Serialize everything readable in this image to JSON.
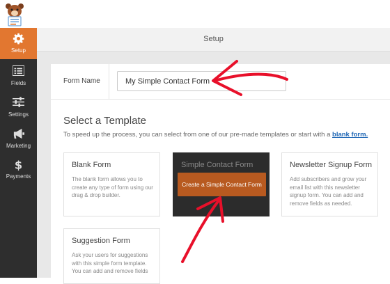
{
  "header": {
    "logo_icon": "wpforms-bear-icon"
  },
  "sidebar": {
    "items": [
      {
        "label": "Setup",
        "icon": "gear-icon",
        "active": true
      },
      {
        "label": "Fields",
        "icon": "list-icon"
      },
      {
        "label": "Settings",
        "icon": "sliders-icon"
      },
      {
        "label": "Marketing",
        "icon": "megaphone-icon"
      },
      {
        "label": "Payments",
        "icon": "dollar-icon"
      }
    ]
  },
  "main": {
    "setup_title": "Setup",
    "form_name_label": "Form Name",
    "form_name_value": "My Simple Contact Form",
    "select_title": "Select a Template",
    "select_desc": "To speed up the process, you can select from one of our pre-made templates or start with a",
    "blank_link": "blank form.",
    "templates": [
      {
        "title": "Blank Form",
        "desc": "The blank form allows you to create any type of form using our drag & drop builder."
      },
      {
        "title": "Simple Contact Form",
        "button": "Create a Simple Contact Form"
      },
      {
        "title": "Newsletter Signup Form",
        "desc": "Add subscribers and grow your email list with this newsletter signup form. You can add and remove fields as needed."
      },
      {
        "title": "Suggestion Form",
        "desc": "Ask your users for suggestions with this simple form template. You can add and remove fields"
      }
    ]
  },
  "colors": {
    "accent": "#e27730",
    "sidebar": "#2e2e2e",
    "arrow": "#e8102a",
    "link": "#1f67b5"
  }
}
